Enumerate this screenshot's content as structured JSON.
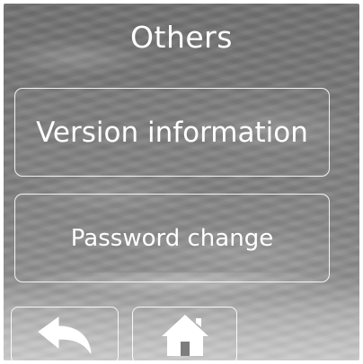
{
  "screen": {
    "title": "Others"
  },
  "menu": {
    "version_label": "Version information",
    "password_label": "Password change"
  },
  "nav": {
    "back_icon": "back-arrow-icon",
    "home_icon": "home-icon"
  },
  "colors": {
    "text": "#ffffff",
    "border": "#ffffff",
    "background": "#7a7a7a"
  }
}
